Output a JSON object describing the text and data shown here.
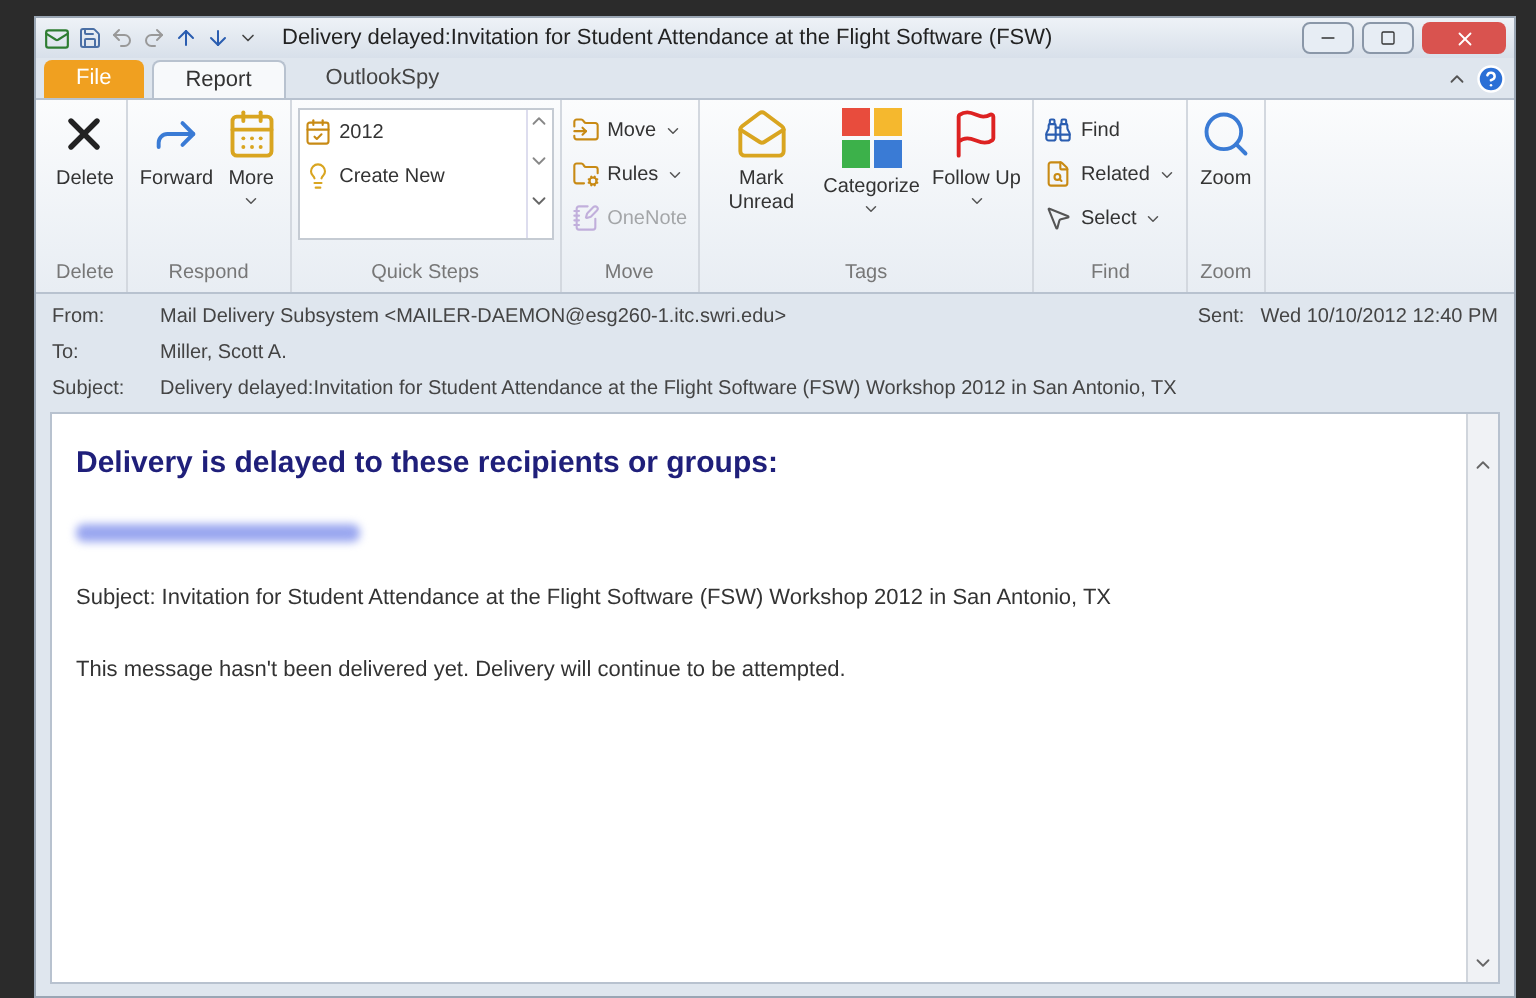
{
  "window": {
    "title": "Delivery delayed:Invitation for Student Attendance at the Flight Software (FSW)"
  },
  "tabs": [
    {
      "label": "File",
      "kind": "file",
      "selected": false
    },
    {
      "label": "Report",
      "kind": "tab",
      "selected": true
    },
    {
      "label": "OutlookSpy",
      "kind": "tab",
      "selected": false
    }
  ],
  "ribbon": {
    "groups": [
      {
        "label": "Delete",
        "kind": "buttons",
        "items": [
          {
            "label": "Delete",
            "kind": "large",
            "dropdown": false,
            "disabled": false
          }
        ]
      },
      {
        "label": "Respond",
        "kind": "buttons",
        "items": [
          {
            "label": "Forward",
            "kind": "large",
            "dropdown": false,
            "disabled": false
          },
          {
            "label": "More",
            "kind": "large",
            "dropdown": true,
            "disabled": false
          }
        ]
      },
      {
        "label": "Quick Steps",
        "kind": "gallery",
        "items": [
          {
            "label": "2012",
            "kind": "small",
            "dropdown": false,
            "disabled": false
          },
          {
            "label": "Create New",
            "kind": "small",
            "dropdown": false,
            "disabled": false
          }
        ]
      },
      {
        "label": "Move",
        "kind": "buttons",
        "items": [
          {
            "label": "Move",
            "kind": "small",
            "dropdown": true,
            "disabled": false
          },
          {
            "label": "Rules",
            "kind": "small",
            "dropdown": true,
            "disabled": false
          },
          {
            "label": "OneNote",
            "kind": "small",
            "dropdown": false,
            "disabled": true
          }
        ]
      },
      {
        "label": "Tags",
        "kind": "buttons",
        "items": [
          {
            "label": "Mark Unread",
            "kind": "large",
            "dropdown": false,
            "disabled": false
          },
          {
            "label": "Categorize",
            "kind": "large",
            "dropdown": true,
            "disabled": false
          },
          {
            "label": "Follow Up",
            "kind": "large",
            "dropdown": true,
            "disabled": false
          }
        ]
      },
      {
        "label": "Find",
        "kind": "buttons",
        "items": [
          {
            "label": "Find",
            "kind": "small",
            "dropdown": false,
            "disabled": false
          },
          {
            "label": "Related",
            "kind": "small",
            "dropdown": true,
            "disabled": false
          },
          {
            "label": "Select",
            "kind": "small",
            "dropdown": true,
            "disabled": false
          }
        ]
      },
      {
        "label": "Zoom",
        "kind": "buttons",
        "items": [
          {
            "label": "Zoom",
            "kind": "large",
            "dropdown": false,
            "disabled": false
          }
        ]
      }
    ]
  },
  "header": {
    "fields": [
      {
        "label": "From:",
        "value": "Mail Delivery Subsystem <MAILER-DAEMON@esg260-1.itc.swri.edu>"
      },
      {
        "label": "To:",
        "value": "Miller, Scott A."
      },
      {
        "label": "Subject:",
        "value": "Delivery delayed:Invitation for Student Attendance at the Flight Software (FSW) Workshop 2012 in San Antonio, TX"
      }
    ],
    "sent": {
      "label": "Sent:",
      "value": "Wed 10/10/2012 12:40 PM"
    }
  },
  "body": {
    "heading": "Delivery is delayed to these recipients or groups:",
    "paragraphs": [
      "Subject: Invitation for Student Attendance at the Flight Software (FSW) Workshop 2012 in San Antonio, TX",
      "This message hasn't been delivered yet. Delivery will continue to be attempted."
    ]
  }
}
